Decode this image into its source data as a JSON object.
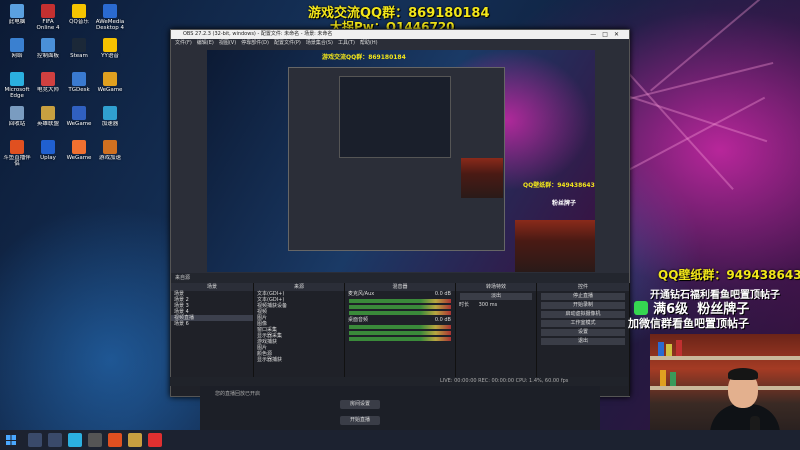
{
  "overlay": {
    "qq_group": "游戏交流QQ群：869180184",
    "boss_pw": "大拐Pw：Q1446720",
    "wallpaper_group": "QQ壁纸群：949438643",
    "fans_badge": "满6级",
    "fans_text": "粉丝牌子",
    "line3": "开通钻石福利看鱼吧置顶帖子",
    "line4": "加微信群看鱼吧置顶帖子",
    "colors": {
      "yellow": "#f2e61a",
      "green": "#35d651",
      "white": "#ffffff"
    }
  },
  "desktop_icons": [
    {
      "label": "此电脑",
      "color": "#5aa0e0"
    },
    {
      "label": "FIFA Online 4",
      "color": "#c43030"
    },
    {
      "label": "QQ音乐",
      "color": "#f5c400"
    },
    {
      "label": "AWeMedia Desktop 4",
      "color": "#2a6ad0"
    },
    {
      "label": "网络",
      "color": "#3a80d0"
    },
    {
      "label": "控制面板",
      "color": "#4a90d8"
    },
    {
      "label": "Steam",
      "color": "#1b2838"
    },
    {
      "label": "YY语音",
      "color": "#f6c200"
    },
    {
      "label": "Microsoft Edge",
      "color": "#2bb0e0"
    },
    {
      "label": "电竞大师",
      "color": "#d04040"
    },
    {
      "label": "TGDesk",
      "color": "#3a7ad0"
    },
    {
      "label": "WeGame",
      "color": "#e0a020"
    },
    {
      "label": "回收站",
      "color": "#7a9cc0"
    },
    {
      "label": "英雄联盟",
      "color": "#c8a040"
    },
    {
      "label": "WeGame",
      "color": "#3060c0"
    },
    {
      "label": "加速器",
      "color": "#30a0d0"
    },
    {
      "label": "斗鱼直播伴侣",
      "color": "#e05020"
    },
    {
      "label": "Uplay",
      "color": "#2060d0"
    },
    {
      "label": "WeGame",
      "color": "#f07030"
    },
    {
      "label": "游戏加速",
      "color": "#d07020"
    }
  ],
  "obs": {
    "title": "OBS 27.2.3 (32-bit, windows) - 配置文件: 未命名 - 场景: 未命名",
    "menu": [
      "文件(F)",
      "编辑(E)",
      "视图(V)",
      "停靠部件(D)",
      "配置文件(P)",
      "场景集合(S)",
      "工具(T)",
      "帮助(H)"
    ],
    "scene_bar": "来自源",
    "docks": {
      "scenes_title": "场景",
      "scenes": [
        "场景",
        "场景 2",
        "场景 3",
        "场景 4",
        "视频直播",
        "场景 6"
      ],
      "sources_title": "来源",
      "sources": [
        "文本(GDI+)",
        "文本(GDI+)",
        "视频捕获设备",
        "视频",
        "图片",
        "图像",
        "窗口采集",
        "显示器采集",
        "游戏捕获",
        "图片",
        "颜色源",
        "显示器捕获"
      ],
      "mixer_title": "混音器",
      "mixer": [
        {
          "name": "麦克风/Aux",
          "level": "0.0 dB"
        },
        {
          "name": "桌面音频",
          "level": "0.0 dB"
        }
      ],
      "transitions_title": "转场特效",
      "transition": "淡出",
      "duration_label": "时长",
      "duration": "300 ms",
      "controls_title": "控件",
      "controls": [
        "停止直播",
        "开始录制",
        "启动虚拟摄像机",
        "工作室模式",
        "设置",
        "退出"
      ]
    },
    "status": "LIVE: 00:00:00   REC: 00:00:00   CPU: 1.4%, 60.00 fps"
  },
  "bg_app": {
    "notice": "您的直播回放已开启",
    "pill_left": "房间设置",
    "pill_right": "开始直播"
  },
  "taskbar_icons": [
    "search",
    "task-view",
    "edge",
    "obs",
    "douyu",
    "game",
    "weibo"
  ]
}
